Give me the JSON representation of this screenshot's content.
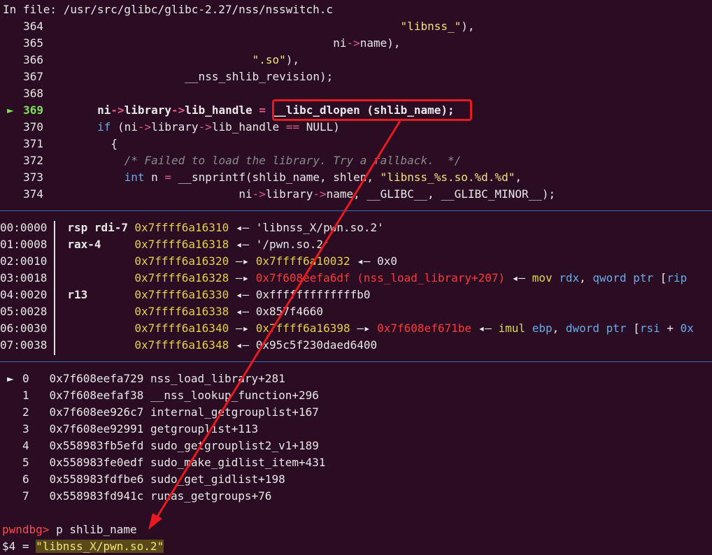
{
  "header": {
    "file_label": "In file: /usr/src/glibc/glibc-2.27/nss/nsswitch.c"
  },
  "source": {
    "current_marker": "►",
    "lines": [
      {
        "num": "364",
        "text": "\"libnss_\"),",
        "indent": 56
      },
      {
        "num": "365",
        "pre": "ni",
        "op": "->",
        "post": "name),",
        "indent": 48
      },
      {
        "num": "366",
        "text": "\".so\"),",
        "indent": 36
      },
      {
        "num": "367",
        "text": "__nss_shlib_revision);",
        "indent": 20
      },
      {
        "num": "368",
        "text": "",
        "indent": 0
      },
      {
        "num": "369",
        "text": "ni->library->lib_handle = __libc_dlopen (shlib_name);",
        "indent": 8,
        "current": true
      },
      {
        "num": "370",
        "text": "if (ni->library->lib_handle == NULL)",
        "indent": 8
      },
      {
        "num": "371",
        "text": "{",
        "indent": 10
      },
      {
        "num": "372",
        "text": "/* Failed to load the library. Try a fallback.  */",
        "indent": 12
      },
      {
        "num": "373",
        "text": "int n = __snprintf(shlib_name, shlen, \"libnss_%s.so.%d.%d\",",
        "indent": 12
      },
      {
        "num": "374",
        "text": "ni->library->name, __GLIBC__, __GLIBC_MINOR__);",
        "indent": 29
      }
    ]
  },
  "stack": [
    {
      "off": "00:0000",
      "reg": "rsp rdi-7",
      "addr": "0x7ffff6a16310",
      "rest": "◂— 'libnss_X/pwn.so.2'"
    },
    {
      "off": "01:0008",
      "reg": "rax-4",
      "addr": "0x7ffff6a16318",
      "rest": "◂— '/pwn.so.2'"
    },
    {
      "off": "02:0010",
      "reg": "",
      "addr": "0x7ffff6a16320",
      "rest": "—▸ 0x7ffff6a10032 ◂— 0x0"
    },
    {
      "off": "03:0018",
      "reg": "",
      "addr": "0x7ffff6a16328",
      "rest": "—▸ 0x7f608eefa6df (nss_load_library+207) ◂— mov rdx, qword ptr [rip"
    },
    {
      "off": "04:0020",
      "reg": "r13",
      "addr": "0x7ffff6a16330",
      "rest": "◂— 0xfffffffffffffb0"
    },
    {
      "off": "05:0028",
      "reg": "",
      "addr": "0x7ffff6a16338",
      "rest": "◂— 0x857f4660"
    },
    {
      "off": "06:0030",
      "reg": "",
      "addr": "0x7ffff6a16340",
      "rest": "—▸ 0x7ffff6a16398 —▸ 0x7f608ef671be ◂— imul ebp, dword ptr [rsi + 0x"
    },
    {
      "off": "07:0038",
      "reg": "",
      "addr": "0x7ffff6a16348",
      "rest": "◂— 0x95c5f230daed6400"
    }
  ],
  "backtrace": {
    "marker": "►",
    "frames": [
      {
        "idx": "0",
        "addr": "0x7f608eefa729",
        "sym": "nss_load_library+281"
      },
      {
        "idx": "1",
        "addr": "0x7f608eefaf38",
        "sym": "__nss_lookup_function+296"
      },
      {
        "idx": "2",
        "addr": "0x7f608ee926c7",
        "sym": "internal_getgrouplist+167"
      },
      {
        "idx": "3",
        "addr": "0x7f608ee92991",
        "sym": "getgrouplist+113"
      },
      {
        "idx": "4",
        "addr": "0x558983fb5efd",
        "sym": "sudo_getgrouplist2_v1+189"
      },
      {
        "idx": "5",
        "addr": "0x558983fe0edf",
        "sym": "sudo_make_gidlist_item+431"
      },
      {
        "idx": "6",
        "addr": "0x558983fdfbe6",
        "sym": "sudo_get_gidlist+198"
      },
      {
        "idx": "7",
        "addr": "0x558983fd941c",
        "sym": "runas_getgroups+76"
      }
    ]
  },
  "console": {
    "prompt": "pwndbg>",
    "command": " p shlib_name",
    "result_prefix": "$4 = ",
    "result_value": "\"libnss_X/pwn.so.2\""
  },
  "colors": {
    "background": "#2a0d22",
    "highlight_box": "#e8191f",
    "separator": "#3b6bb5"
  }
}
